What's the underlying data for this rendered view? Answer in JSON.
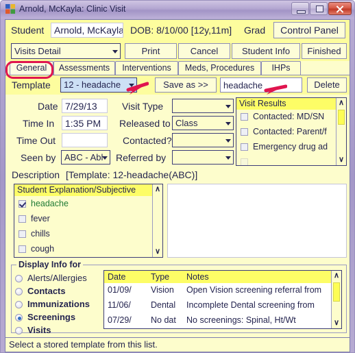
{
  "window": {
    "title": "Arnold, McKayla: Clinic Visit",
    "icon": "app-puzzle-icon",
    "controls": {
      "minimize": "minimize-icon",
      "maximize": "maximize-icon",
      "close": "close-icon"
    }
  },
  "student_bar": {
    "label": "Student",
    "name": "Arnold, McKayla",
    "dob": "DOB: 8/10/00 [12y,11m]",
    "grade_label": "Grad",
    "control_panel": "Control Panel"
  },
  "toolbar": {
    "view_select": "Visits Detail",
    "print": "Print",
    "cancel": "Cancel",
    "student_info": "Student Info",
    "finished": "Finished"
  },
  "tabs": [
    {
      "label": "General",
      "active": true
    },
    {
      "label": "Assessments",
      "active": false
    },
    {
      "label": "Interventions",
      "active": false
    },
    {
      "label": "Meds, Procedures",
      "active": false
    },
    {
      "label": "IHPs",
      "active": false
    }
  ],
  "template_row": {
    "label": "Template",
    "selected": "12 - headache",
    "save_as": "Save as >>",
    "save_name": "headache",
    "delete": "Delete"
  },
  "form": {
    "date_label": "Date",
    "date_value": "7/29/13",
    "time_in_label": "Time In",
    "time_in_value": "1:35 PM",
    "time_out_label": "Time Out",
    "time_out_value": "",
    "seen_by_label": "Seen by",
    "seen_by_value": "ABC - Abl",
    "visit_type_label": "Visit Type",
    "visit_type_value": "",
    "released_to_label": "Released to",
    "released_to_value": "Class",
    "contacted_label": "Contacted?",
    "contacted_value": "",
    "referred_by_label": "Referred by",
    "referred_by_value": "",
    "description_label": "Description",
    "description_value": "[Template: 12-headache(ABC)]"
  },
  "visit_results": {
    "header": "Visit Results",
    "items": [
      {
        "label": "Contacted: MD/SN",
        "checked": false
      },
      {
        "label": "Contacted: Parent/f",
        "checked": false
      },
      {
        "label": "Emergency drug ad",
        "checked": false
      }
    ],
    "scroll_up": "∧",
    "scroll_down": "∨"
  },
  "student_explanation": {
    "header": "Student Explanation/Subjective",
    "items": [
      {
        "label": "headache",
        "checked": true
      },
      {
        "label": "fever",
        "checked": false
      },
      {
        "label": "chills",
        "checked": false
      },
      {
        "label": "cough",
        "checked": false
      }
    ],
    "scroll_up": "∧",
    "scroll_down": "∨"
  },
  "notes_area": {
    "value": ""
  },
  "display_info": {
    "title": "Display Info for",
    "options": [
      {
        "label": "Alerts/Allergies",
        "selected": false
      },
      {
        "label": "Contacts",
        "selected": false
      },
      {
        "label": "Immunizations",
        "selected": false
      },
      {
        "label": "Screenings",
        "selected": true
      },
      {
        "label": "Visits",
        "selected": false
      }
    ]
  },
  "info_table": {
    "columns": [
      "Date",
      "Type",
      "Notes"
    ],
    "rows": [
      {
        "date": "01/09/",
        "type": "Vision",
        "notes": "Open Vision screening referral from"
      },
      {
        "date": "11/06/",
        "type": "Dental",
        "notes": "Incomplete Dental screening from"
      },
      {
        "date": "07/29/",
        "type": "No dat",
        "notes": "No screenings: Spinal, Ht/Wt"
      }
    ],
    "scroll_up": "∧",
    "scroll_down": "∨"
  },
  "status_bar": {
    "text": "Select a stored template from this list."
  },
  "annotations": {
    "highlight_color": "#e0154f",
    "ring_target": "General tab",
    "arrow1_target": "template dropdown",
    "arrow2_target": "save name field"
  }
}
